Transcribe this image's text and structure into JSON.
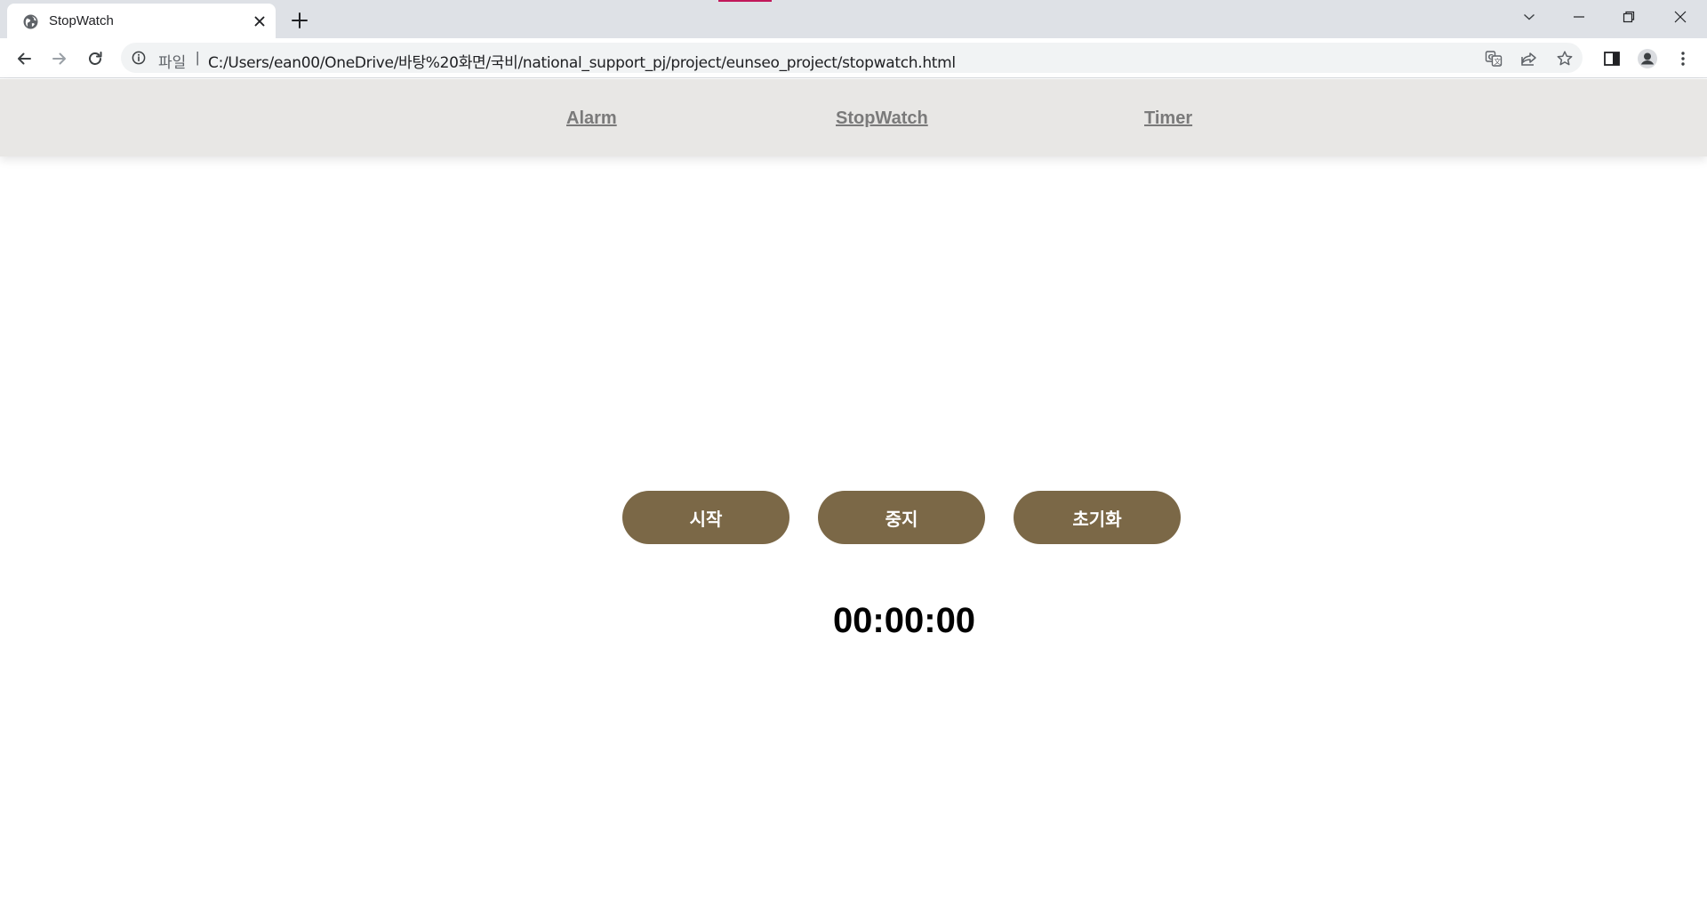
{
  "browser": {
    "tab": {
      "title": "StopWatch"
    },
    "address_bar": {
      "scheme_label": "파일",
      "separator": "|",
      "url": "C:/Users/ean00/OneDrive/바탕%20화면/국비/national_support_pj/project/eunseo_project/stopwatch.html"
    },
    "icons": {
      "favicon": "globe-icon",
      "close": "close-icon",
      "new_tab": "plus-icon",
      "back": "arrow-left-icon",
      "forward": "arrow-right-icon",
      "reload": "reload-icon",
      "info": "info-icon",
      "translate": "translate-icon",
      "share": "share-icon",
      "bookmark": "star-icon",
      "side_panel": "side-panel-icon",
      "profile": "profile-icon",
      "menu": "kebab-menu-icon"
    },
    "colors": {
      "tab_accent": "#c2185b",
      "tabstrip": "#dee1e6"
    }
  },
  "site_nav": {
    "links": [
      {
        "label": "Alarm"
      },
      {
        "label": "StopWatch"
      },
      {
        "label": "Timer"
      }
    ],
    "background": "#e8e7e5",
    "link_color": "#7a7a7a"
  },
  "stopwatch": {
    "buttons": {
      "start": "시작",
      "stop": "중지",
      "reset": "초기화"
    },
    "button_color": "#7b6847",
    "time": "00:00:00"
  }
}
